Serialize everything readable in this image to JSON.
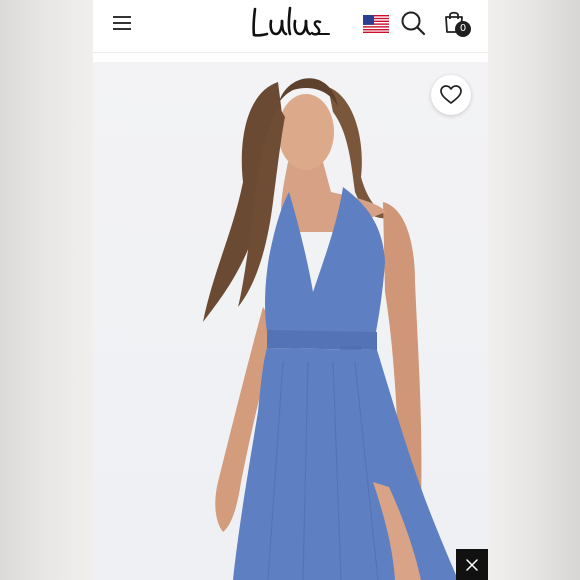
{
  "header": {
    "brand": "Lulus",
    "menu_icon": "hamburger-menu-icon",
    "flag_icon": "us-flag-icon",
    "search_icon": "search-icon",
    "bag_icon": "shopping-bag-icon",
    "bag_count": "0"
  },
  "product": {
    "image": "model-in-blue-halter-maxi-dress",
    "dress_color": "#5e7fc2",
    "wishlist_icon": "heart-outline-icon"
  },
  "overlay": {
    "close_icon": "close-icon"
  },
  "colors": {
    "header_bg": "#ffffff",
    "accent_dark": "#1f1f1f",
    "close_bg": "#111111"
  }
}
